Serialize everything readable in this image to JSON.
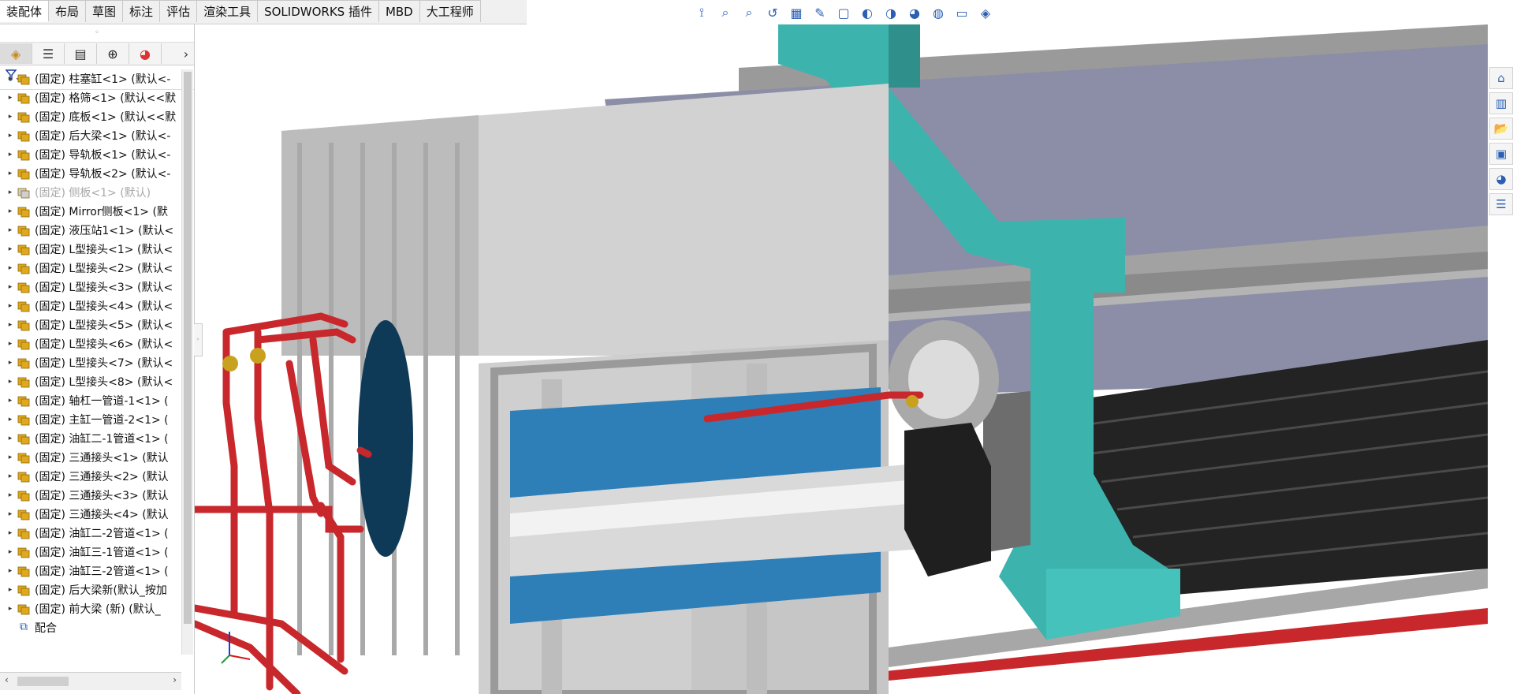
{
  "tabs": [
    "装配体",
    "布局",
    "草图",
    "标注",
    "评估",
    "渲染工具",
    "SOLIDWORKS 插件",
    "MBD",
    "大工程师"
  ],
  "active_tab_index": 0,
  "hud_icons": [
    "view-orientation-icon",
    "zoom-to-fit-icon",
    "zoom-area-icon",
    "previous-view-icon",
    "section-view-icon",
    "dynamic-annotation-icon",
    "view-selector-icon",
    "display-style-icon",
    "hide-show-items-icon",
    "edit-appearance-icon",
    "apply-scene-icon",
    "view-settings-icon",
    "3d-box-icon"
  ],
  "panel_tabs": [
    "featuremanager-tab",
    "propertymanager-tab",
    "configurationmanager-tab",
    "dimxpertmanager-tab",
    "displaymanager-tab"
  ],
  "tree_items": [
    {
      "label": "(固定) 柱塞缸<1> (默认<-",
      "suppressed": false
    },
    {
      "label": "(固定) 格筛<1> (默认<<默",
      "suppressed": false
    },
    {
      "label": "(固定) 底板<1> (默认<<默",
      "suppressed": false
    },
    {
      "label": "(固定) 后大梁<1> (默认<-",
      "suppressed": false
    },
    {
      "label": "(固定) 导轨板<1> (默认<-",
      "suppressed": false
    },
    {
      "label": "(固定) 导轨板<2> (默认<-",
      "suppressed": false
    },
    {
      "label": "(固定) 侧板<1> (默认)",
      "suppressed": true
    },
    {
      "label": "(固定) Mirror侧板<1> (默",
      "suppressed": false
    },
    {
      "label": "(固定) 液压站1<1> (默认<",
      "suppressed": false
    },
    {
      "label": "(固定) L型接头<1> (默认<",
      "suppressed": false
    },
    {
      "label": "(固定) L型接头<2> (默认<",
      "suppressed": false
    },
    {
      "label": "(固定) L型接头<3> (默认<",
      "suppressed": false
    },
    {
      "label": "(固定) L型接头<4> (默认<",
      "suppressed": false
    },
    {
      "label": "(固定) L型接头<5> (默认<",
      "suppressed": false
    },
    {
      "label": "(固定) L型接头<6> (默认<",
      "suppressed": false
    },
    {
      "label": "(固定) L型接头<7> (默认<",
      "suppressed": false
    },
    {
      "label": "(固定) L型接头<8> (默认<",
      "suppressed": false
    },
    {
      "label": "(固定) 轴杠一管道-1<1> (",
      "suppressed": false
    },
    {
      "label": "(固定) 主缸一管道-2<1> (",
      "suppressed": false
    },
    {
      "label": "(固定) 油缸二-1管道<1> (",
      "suppressed": false
    },
    {
      "label": "(固定) 三通接头<1> (默认",
      "suppressed": false
    },
    {
      "label": "(固定) 三通接头<2> (默认",
      "suppressed": false
    },
    {
      "label": "(固定) 三通接头<3> (默认",
      "suppressed": false
    },
    {
      "label": "(固定) 三通接头<4> (默认",
      "suppressed": false
    },
    {
      "label": "(固定) 油缸二-2管道<1> (",
      "suppressed": false
    },
    {
      "label": "(固定) 油缸三-1管道<1> (",
      "suppressed": false
    },
    {
      "label": "(固定) 油缸三-2管道<1> (",
      "suppressed": false
    },
    {
      "label": "(固定) 后大梁新(默认_按加",
      "suppressed": false
    },
    {
      "label": "(固定) 前大梁 (新) (默认_",
      "suppressed": false
    }
  ],
  "mates_label": "配合",
  "taskpane_icons": [
    "home-icon",
    "design-library-icon",
    "file-explorer-icon",
    "view-palette-icon",
    "appearances-icon",
    "custom-properties-icon"
  ],
  "colors": {
    "teal": "#3db3ad",
    "pipe_red": "#c8282c",
    "frame_gray": "#b9b9b9",
    "plate_purple": "#8b8ea6",
    "grid_black": "#232323",
    "cylinder_blue": "#2e7fb8"
  }
}
